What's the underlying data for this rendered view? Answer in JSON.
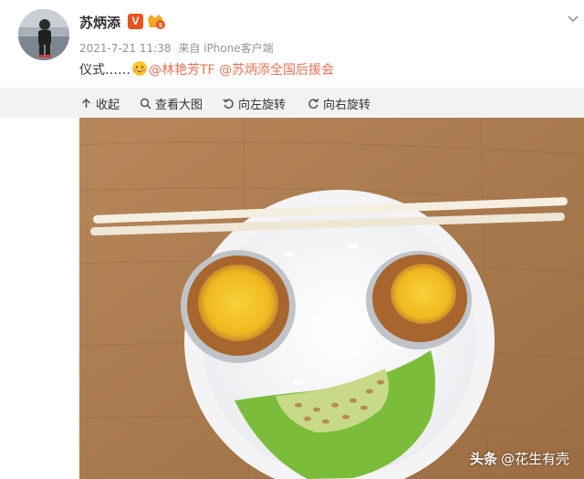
{
  "post": {
    "username": "苏炳添",
    "verified_badge": "V",
    "date": "2021-7-21 11:38",
    "source": "来自 iPhone客户端",
    "text": "仪式……",
    "mentions": [
      "@林艳芳TF",
      "@苏炳添全国后援会"
    ]
  },
  "toolbar": {
    "collapse": "收起",
    "view_large": "查看大图",
    "rotate_left": "向左旋转",
    "rotate_right": "向右旋转"
  },
  "photo": {
    "watermark_brand": "头条",
    "watermark_author": "@花生有壳"
  },
  "icons": {
    "collapse": "arrow-up-icon",
    "view_large": "magnifier-icon",
    "rotate_left": "rotate-left-icon",
    "rotate_right": "rotate-right-icon",
    "more": "chevron-down-icon"
  },
  "colors": {
    "mention": "#eb7350",
    "verified": "#e8531c",
    "meta_text": "#939393",
    "toolbar_bg": "#f2f2f2"
  }
}
